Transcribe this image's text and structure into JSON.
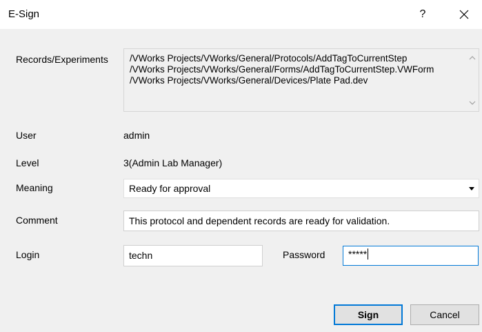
{
  "window": {
    "title": "E-Sign",
    "help_label": "?",
    "close_icon": "close-icon"
  },
  "records": {
    "label": "Records/Experiments",
    "lines": [
      "/VWorks Projects/VWorks/General/Protocols/AddTagToCurrentStep",
      "/VWorks Projects/VWorks/General/Forms/AddTagToCurrentStep.VWForm",
      "/VWorks Projects/VWorks/General/Devices/Plate Pad.dev"
    ]
  },
  "user": {
    "label": "User",
    "value": "admin"
  },
  "level": {
    "label": "Level",
    "value": "3(Admin Lab Manager)"
  },
  "meaning": {
    "label": "Meaning",
    "selected": "Ready for approval"
  },
  "comment": {
    "label": "Comment",
    "value": "This protocol and dependent records are ready for validation."
  },
  "login": {
    "label": "Login",
    "value": "techn"
  },
  "password": {
    "label": "Password",
    "value": "*****"
  },
  "buttons": {
    "sign": "Sign",
    "cancel": "Cancel"
  },
  "colors": {
    "accent": "#0078d7",
    "background": "#f0f0f0"
  }
}
